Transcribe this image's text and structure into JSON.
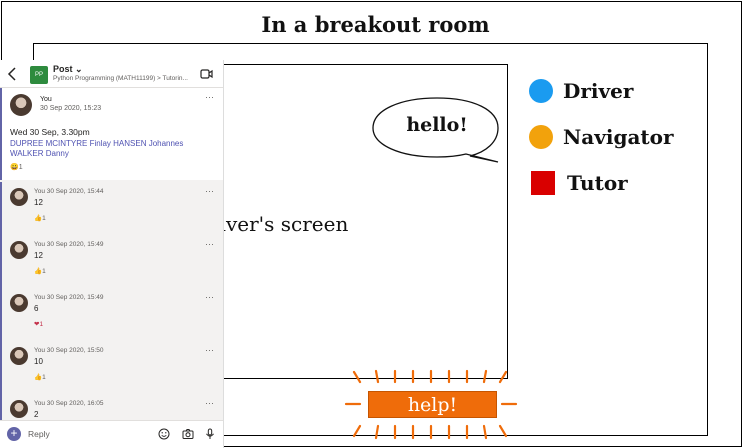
{
  "slide": {
    "title": "In a breakout room",
    "driver_screen_label": "river's screen",
    "speech_bubble": "hello!",
    "help_label": "help!"
  },
  "legend": [
    {
      "label": "Driver",
      "color": "#1a9bf0",
      "shape": "circle"
    },
    {
      "label": "Navigator",
      "color": "#f2a20c",
      "shape": "circle"
    },
    {
      "label": "Tutor",
      "color": "#d90000",
      "shape": "square"
    }
  ],
  "teams": {
    "header": {
      "title": "Post",
      "subtitle": "Python Programming (MATH11199) > Tutorin...",
      "team_initials": "PP"
    },
    "root_post": {
      "author": "You",
      "timestamp": "30 Sep 2020, 15:23",
      "body": "Wed 30 Sep, 3.30pm",
      "mentions": "DUPREE MCINTYRE Finlay HANSEN Johannes WALKER Danny",
      "reaction": "😀1"
    },
    "replies": [
      {
        "meta": "You 30 Sep 2020, 15:44",
        "text": "12",
        "reaction": "👍1"
      },
      {
        "meta": "You 30 Sep 2020, 15:49",
        "text": "12",
        "reaction": "👍1"
      },
      {
        "meta": "You 30 Sep 2020, 15:49",
        "text": "6",
        "reaction": "❤1"
      },
      {
        "meta": "You 30 Sep 2020, 15:50",
        "text": "10",
        "reaction": "👍1"
      },
      {
        "meta": "You 30 Sep 2020, 16:05",
        "text": "2",
        "reaction": ""
      }
    ],
    "more_glyph": "···",
    "composer": {
      "placeholder": "Reply"
    }
  }
}
